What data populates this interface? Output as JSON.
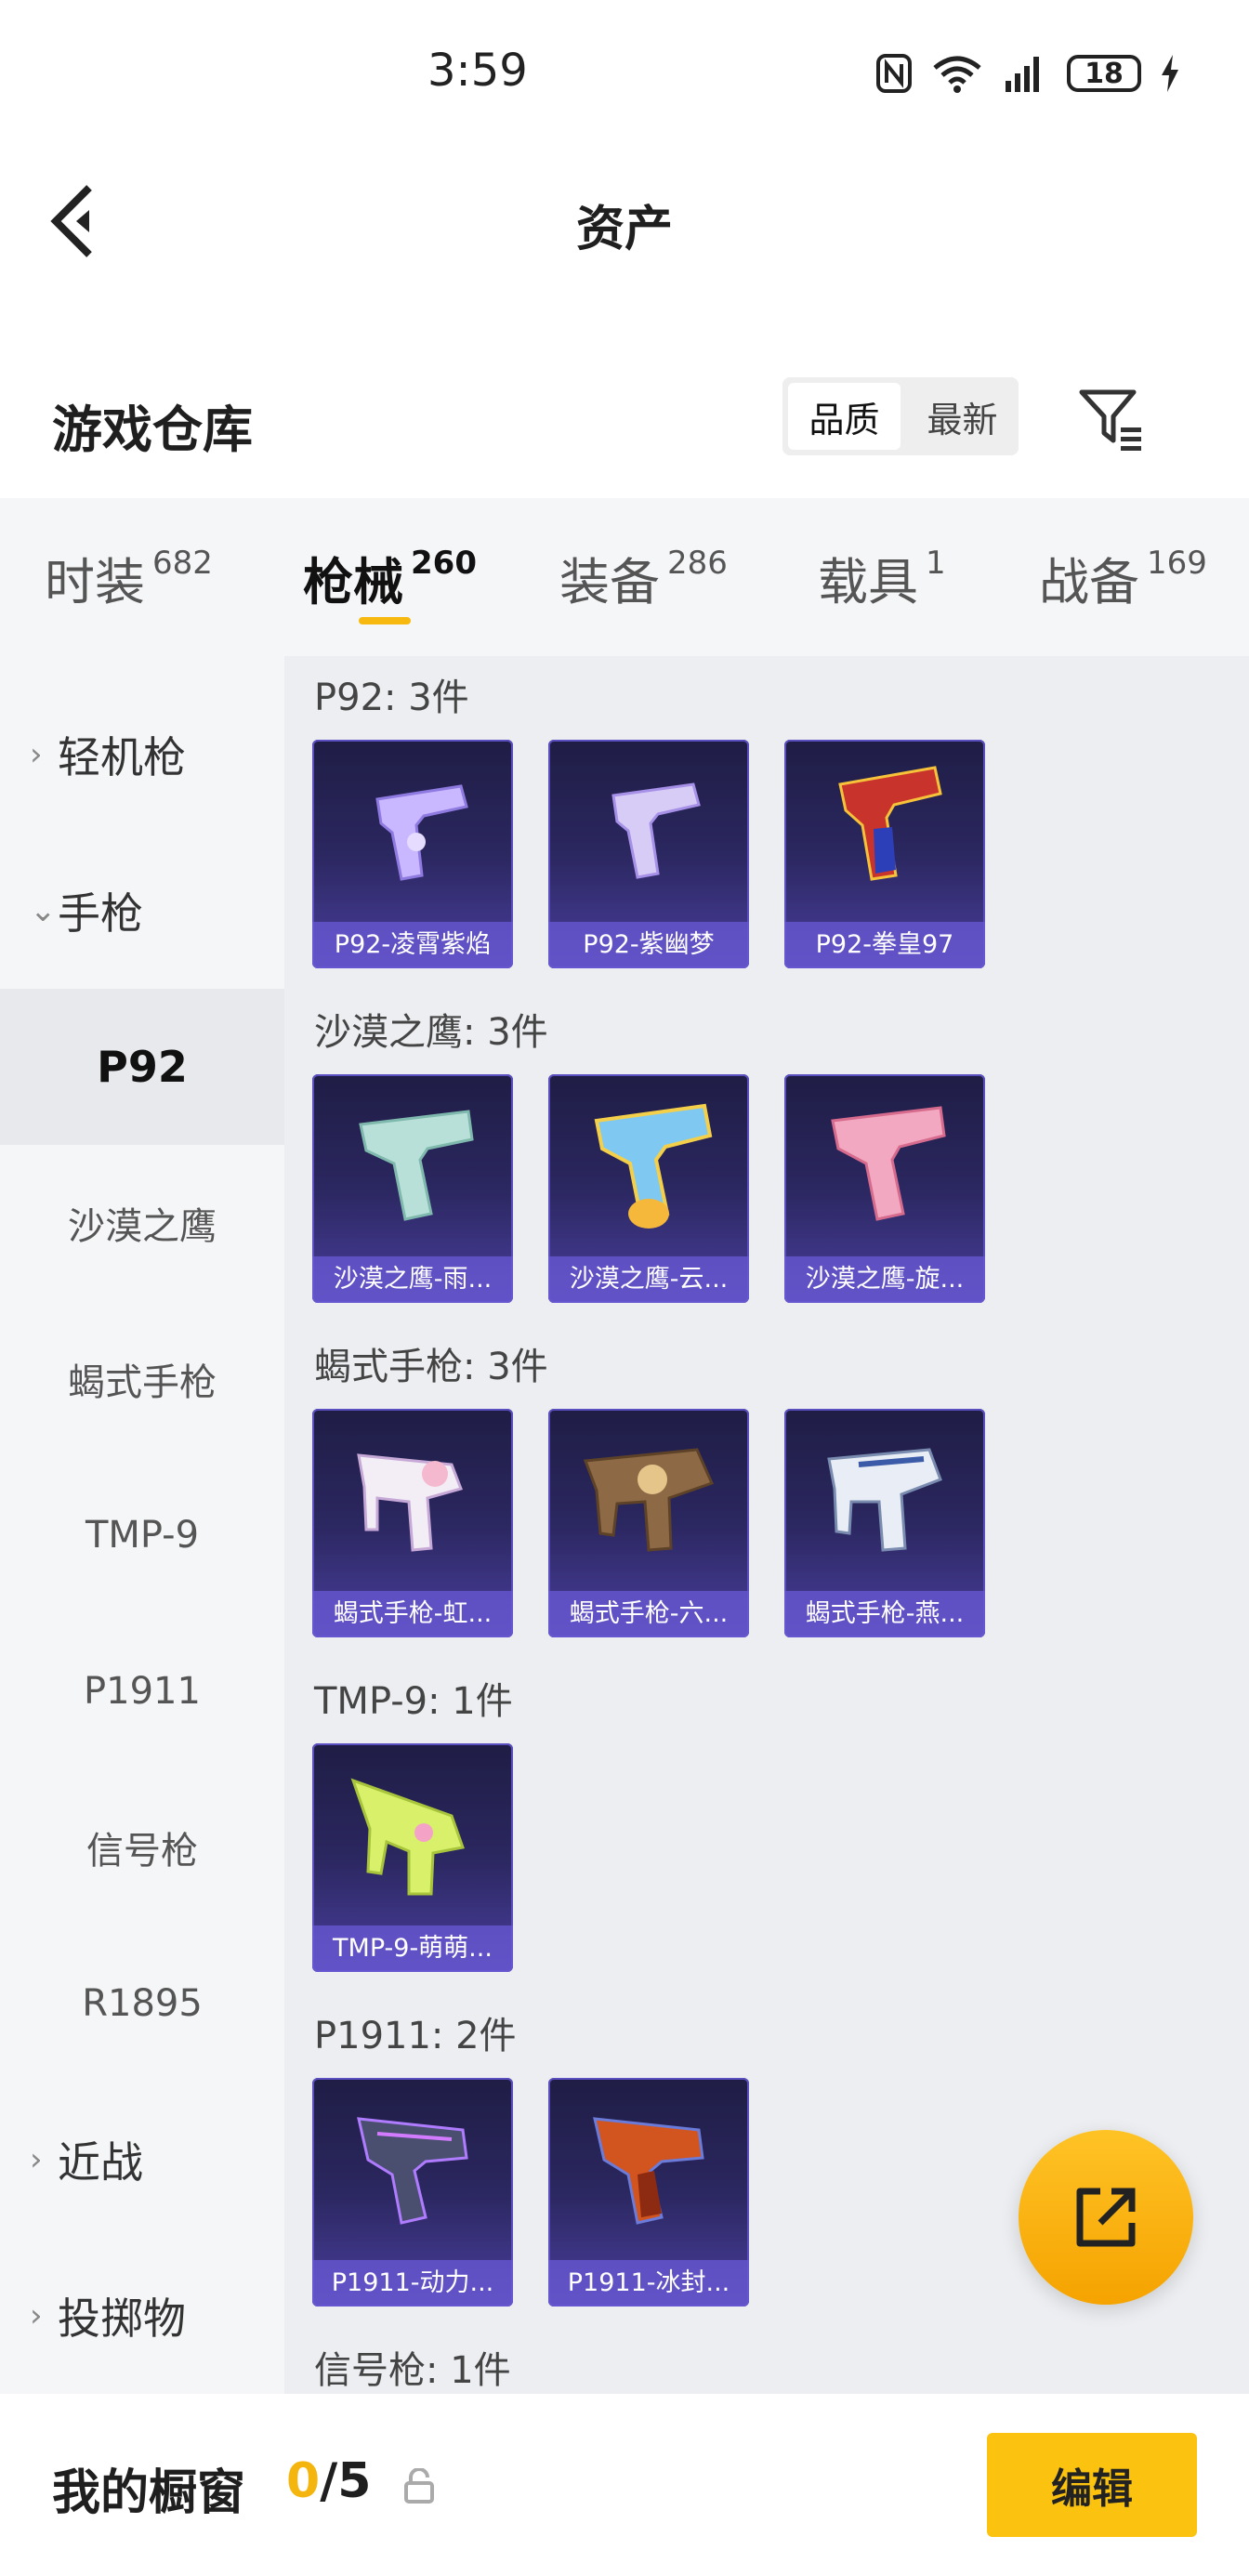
{
  "status_bar": {
    "time": "3:59",
    "battery": "18"
  },
  "header": {
    "title": "资产"
  },
  "warehouse": {
    "title": "游戏仓库",
    "sort_options": [
      "品质",
      "最新"
    ],
    "sort_selected": "品质"
  },
  "tabs": [
    {
      "label": "时装",
      "count": "682"
    },
    {
      "label": "枪械",
      "count": "260",
      "active": true
    },
    {
      "label": "装备",
      "count": "286"
    },
    {
      "label": "载具",
      "count": "1"
    },
    {
      "label": "战备",
      "count": "169"
    }
  ],
  "sidebar": {
    "items": [
      {
        "label": "轻机枪",
        "type": "category",
        "expanded": false
      },
      {
        "label": "手枪",
        "type": "category",
        "expanded": true
      },
      {
        "label": "P92",
        "type": "sub",
        "selected": true
      },
      {
        "label": "沙漠之鹰",
        "type": "sub"
      },
      {
        "label": "蝎式手枪",
        "type": "sub"
      },
      {
        "label": "TMP-9",
        "type": "sub"
      },
      {
        "label": "P1911",
        "type": "sub"
      },
      {
        "label": "信号枪",
        "type": "sub"
      },
      {
        "label": "R1895",
        "type": "sub"
      },
      {
        "label": "近战",
        "type": "category",
        "expanded": false
      },
      {
        "label": "投掷物",
        "type": "category",
        "expanded": false
      }
    ]
  },
  "groups": [
    {
      "title": "P92: 3件",
      "items": [
        "P92-凌霄紫焰",
        "P92-紫幽梦",
        "P92-拳皇97"
      ]
    },
    {
      "title": "沙漠之鹰: 3件",
      "items": [
        "沙漠之鹰-雨...",
        "沙漠之鹰-云...",
        "沙漠之鹰-旋..."
      ]
    },
    {
      "title": "蝎式手枪: 3件",
      "items": [
        "蝎式手枪-虹...",
        "蝎式手枪-六...",
        "蝎式手枪-燕..."
      ]
    },
    {
      "title": "TMP-9: 1件",
      "items": [
        "TMP-9-萌萌..."
      ]
    },
    {
      "title": "P1911: 2件",
      "items": [
        "P1911-动力...",
        "P1911-冰封..."
      ]
    },
    {
      "title": "信号枪: 1件",
      "items": []
    }
  ],
  "showcase": {
    "label": "我的橱窗",
    "current": "0",
    "separator": "/",
    "max": "5",
    "edit_label": "编辑"
  },
  "colors": {
    "accent": "#f7b90f",
    "card_label": "#6a5ad6",
    "card_bg": "#2b2760"
  }
}
